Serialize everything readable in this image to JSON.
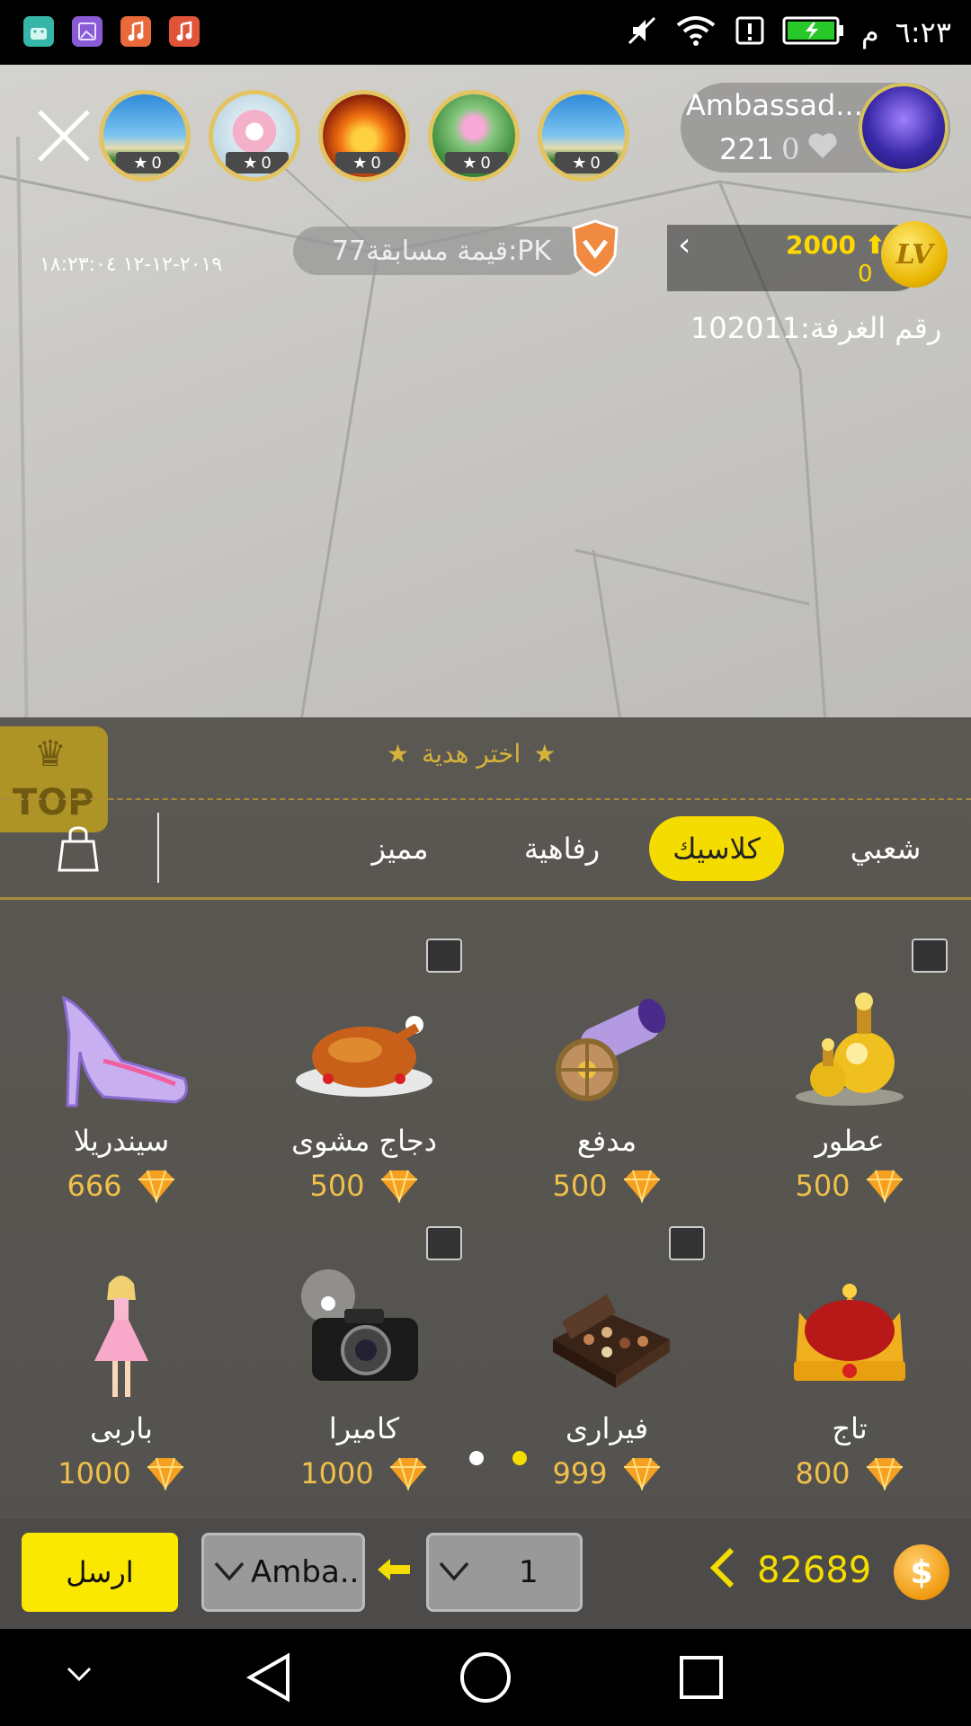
{
  "status_bar": {
    "time": "٦:٢٣",
    "ampm": "م",
    "icons": [
      "android-icon",
      "gallery-icon",
      "music-icon",
      "music-icon",
      "mute-icon",
      "wifi-icon",
      "data-icon",
      "battery-icon"
    ]
  },
  "header": {
    "host_name": "Ambassad...",
    "host_count": "221",
    "host_hearts": "0",
    "viewers": [
      {
        "stars": "0",
        "scene": "beach"
      },
      {
        "stars": "0",
        "scene": "daisy"
      },
      {
        "stars": "0",
        "scene": "fire"
      },
      {
        "stars": "0",
        "scene": "lotus"
      },
      {
        "stars": "0",
        "scene": "beach"
      }
    ],
    "pk_label": "قيمة مسابقة77:PK",
    "datetime": "٢٠١٩-١٢-١٢ ١٨:٢٣:٠٤",
    "level_up": "2000",
    "level_down": "0",
    "level_badge": "LV",
    "room_number": "رقم الغرفة:102011"
  },
  "gift_panel": {
    "top_badge": "TOP",
    "title": "اختر هدية",
    "tabs": [
      {
        "label": "شعبي",
        "active": false
      },
      {
        "label": "كلاسيك",
        "active": true
      },
      {
        "label": "رفاهية",
        "active": false
      },
      {
        "label": "مميز",
        "active": false
      }
    ],
    "gifts": [
      {
        "name": "عطور",
        "price": "500",
        "art": "perfume",
        "fx": true
      },
      {
        "name": "مدفع",
        "price": "500",
        "art": "cannon",
        "fx": false
      },
      {
        "name": "دجاج مشوى",
        "price": "500",
        "art": "chicken",
        "fx": true
      },
      {
        "name": "سيندريلا",
        "price": "666",
        "art": "shoe",
        "fx": false
      },
      {
        "name": "تاج",
        "price": "800",
        "art": "crown",
        "fx": false
      },
      {
        "name": "فيرارى",
        "price": "999",
        "art": "chocolates",
        "fx": true
      },
      {
        "name": "كاميرا",
        "price": "1000",
        "art": "camera",
        "fx": true
      },
      {
        "name": "باربى",
        "price": "1000",
        "art": "doll",
        "fx": false
      }
    ],
    "page_dots": {
      "count": 2,
      "active": 1
    }
  },
  "action_bar": {
    "send_label": "ارسل",
    "recipient": "Amba...",
    "quantity": "1",
    "balance": "82689",
    "coin_symbol": "$"
  },
  "colors": {
    "accent_yellow": "#f5dc00",
    "gold": "#f0c04a",
    "panel_bg": "#5e5b56",
    "action_bg": "#4c4b49"
  }
}
